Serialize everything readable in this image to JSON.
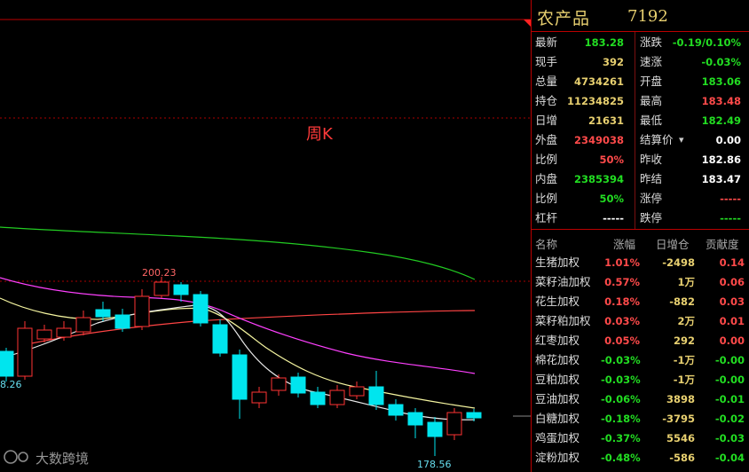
{
  "chart": {
    "period_label": "周K",
    "high_label": "200.23",
    "low_label": "178.56",
    "left_label": "8.26",
    "watermark": "大数跨境",
    "colors": {
      "up": "#ff3333",
      "down": "#00e5ee",
      "ma1": "#f5f5a0",
      "ma2": "#ff40ff",
      "ma3": "#22cc22",
      "ma4": "#ff4444"
    }
  },
  "panel": {
    "name": "农产品",
    "code": "7192",
    "quote_left": [
      {
        "label": "最新",
        "value": "183.28",
        "color": "green"
      },
      {
        "label": "现手",
        "value": "392",
        "color": "yellow"
      },
      {
        "label": "总量",
        "value": "4734261",
        "color": "yellow"
      },
      {
        "label": "持仓",
        "value": "11234825",
        "color": "yellow"
      },
      {
        "label": "日增",
        "value": "21631",
        "color": "yellow"
      },
      {
        "label": "外盘",
        "value": "2349038",
        "color": "red"
      },
      {
        "label": "比例",
        "value": "50%",
        "color": "red"
      },
      {
        "label": "内盘",
        "value": "2385394",
        "color": "green"
      },
      {
        "label": "比例",
        "value": "50%",
        "color": "green"
      },
      {
        "label": "杠杆",
        "value": "-----",
        "color": "white"
      }
    ],
    "quote_right": [
      {
        "label": "涨跌",
        "value": "-0.19/0.10%",
        "color": "green"
      },
      {
        "label": "速涨",
        "value": "-0.03%",
        "color": "green"
      },
      {
        "label": "开盘",
        "value": "183.06",
        "color": "green"
      },
      {
        "label": "最高",
        "value": "183.48",
        "color": "red"
      },
      {
        "label": "最低",
        "value": "182.49",
        "color": "green"
      },
      {
        "label": "结算价",
        "value": "0.00",
        "color": "white"
      },
      {
        "label": "昨收",
        "value": "182.86",
        "color": "white"
      },
      {
        "label": "昨结",
        "value": "183.47",
        "color": "white"
      },
      {
        "label": "涨停",
        "value": "-----",
        "color": "red"
      },
      {
        "label": "跌停",
        "value": "-----",
        "color": "green"
      }
    ],
    "table_headers": [
      "名称",
      "涨幅",
      "日增仓",
      "贡献度"
    ],
    "table_rows": [
      {
        "name": "生猪加权",
        "chg": "1.01%",
        "chg_color": "red",
        "day": "-2498",
        "con": "0.14",
        "con_color": "red"
      },
      {
        "name": "菜籽油加权",
        "chg": "0.57%",
        "chg_color": "red",
        "day": "1万",
        "con": "0.06",
        "con_color": "red"
      },
      {
        "name": "花生加权",
        "chg": "0.18%",
        "chg_color": "red",
        "day": "-882",
        "con": "0.03",
        "con_color": "red"
      },
      {
        "name": "菜籽粕加权",
        "chg": "0.03%",
        "chg_color": "red",
        "day": "2万",
        "con": "0.01",
        "con_color": "red"
      },
      {
        "name": "红枣加权",
        "chg": "0.05%",
        "chg_color": "red",
        "day": "292",
        "con": "0.00",
        "con_color": "red"
      },
      {
        "name": "棉花加权",
        "chg": "-0.03%",
        "chg_color": "green",
        "day": "-1万",
        "con": "-0.00",
        "con_color": "green"
      },
      {
        "name": "豆粕加权",
        "chg": "-0.03%",
        "chg_color": "green",
        "day": "-1万",
        "con": "-0.00",
        "con_color": "green"
      },
      {
        "name": "豆油加权",
        "chg": "-0.06%",
        "chg_color": "green",
        "day": "3898",
        "con": "-0.01",
        "con_color": "green"
      },
      {
        "name": "白糖加权",
        "chg": "-0.18%",
        "chg_color": "green",
        "day": "-3795",
        "con": "-0.02",
        "con_color": "green"
      },
      {
        "name": "鸡蛋加权",
        "chg": "-0.37%",
        "chg_color": "green",
        "day": "5546",
        "con": "-0.03",
        "con_color": "green"
      },
      {
        "name": "淀粉加权",
        "chg": "-0.48%",
        "chg_color": "green",
        "day": "-586",
        "con": "-0.04",
        "con_color": "green"
      }
    ]
  }
}
